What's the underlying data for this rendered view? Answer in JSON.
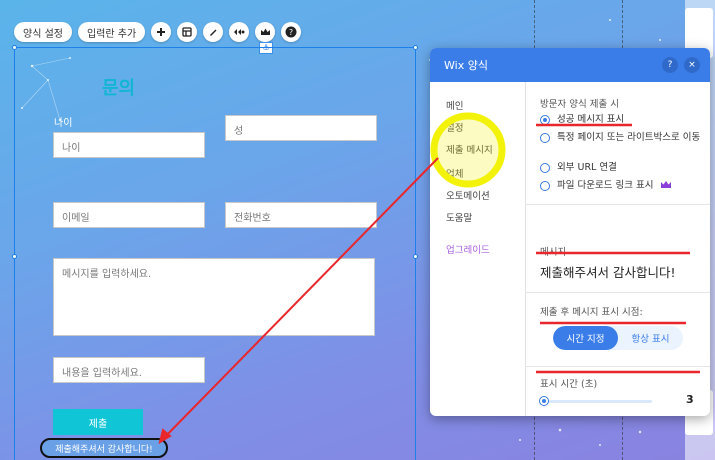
{
  "toolbar": {
    "form_settings": "양식 설정",
    "add_field": "입력란 추가"
  },
  "form": {
    "title": "문의",
    "first_name_label": "나이",
    "first_name_placeholder": "나이",
    "last_name_placeholder": "성",
    "email_placeholder": "이메일",
    "phone_placeholder": "전화번호",
    "message_placeholder": "메시지를 입력하세요.",
    "content_placeholder": "내용을 입력하세요.",
    "submit_label": "제출",
    "success_text": "제출해주셔서 감사합니다!"
  },
  "panel": {
    "title": "Wix 양식",
    "help": "?",
    "close": "×",
    "nav": [
      "메인",
      "설정",
      "제출 메시지",
      "업체",
      "오토메이션",
      "도움말"
    ],
    "upgrade": "업그레이드",
    "on_submit_title": "방문자 양식 제출 시",
    "options": [
      "성공 메시지 표시",
      "특정 페이지 또는 라이트박스로 이동",
      "외부 URL 연결",
      "파일 다운로드 링크 표시"
    ],
    "message_title": "메시지",
    "message_text": "제출해주셔서 감사합니다!",
    "timing_title": "제출 후 메시지 표시 시점:",
    "timing_options": [
      "시간 지정",
      "항상 표시"
    ],
    "duration_title": "표시 시간 (초)",
    "duration_value": "3"
  },
  "colors": {
    "wix_blue": "#3b7de8",
    "form_accent": "#0fc5d6",
    "highlight_yellow": "#f2f20a",
    "annotation_red": "#e8262b"
  }
}
